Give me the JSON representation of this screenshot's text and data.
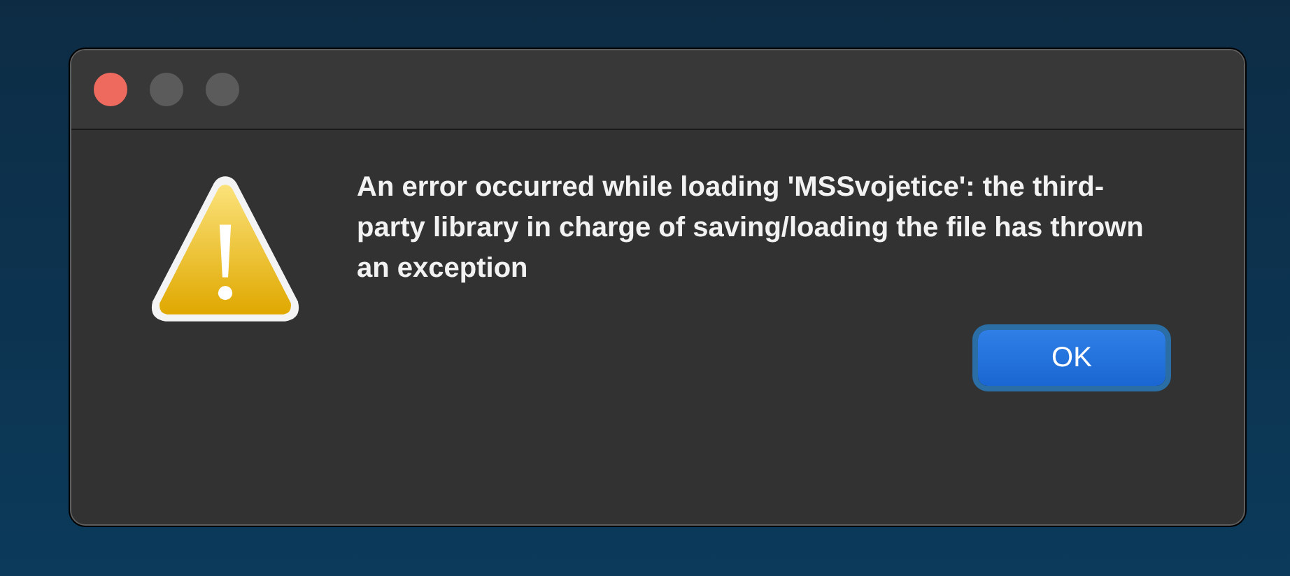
{
  "window": {
    "controls": [
      {
        "kind": "close",
        "disabled": false
      },
      {
        "kind": "minimize",
        "disabled": true
      },
      {
        "kind": "zoom",
        "disabled": true
      }
    ]
  },
  "message": "An error occurred while loading 'MSSvojetice': the third-party library in charge of saving/loading the file has thrown an exception",
  "buttons": [
    {
      "label": "OK",
      "focused": true
    }
  ]
}
